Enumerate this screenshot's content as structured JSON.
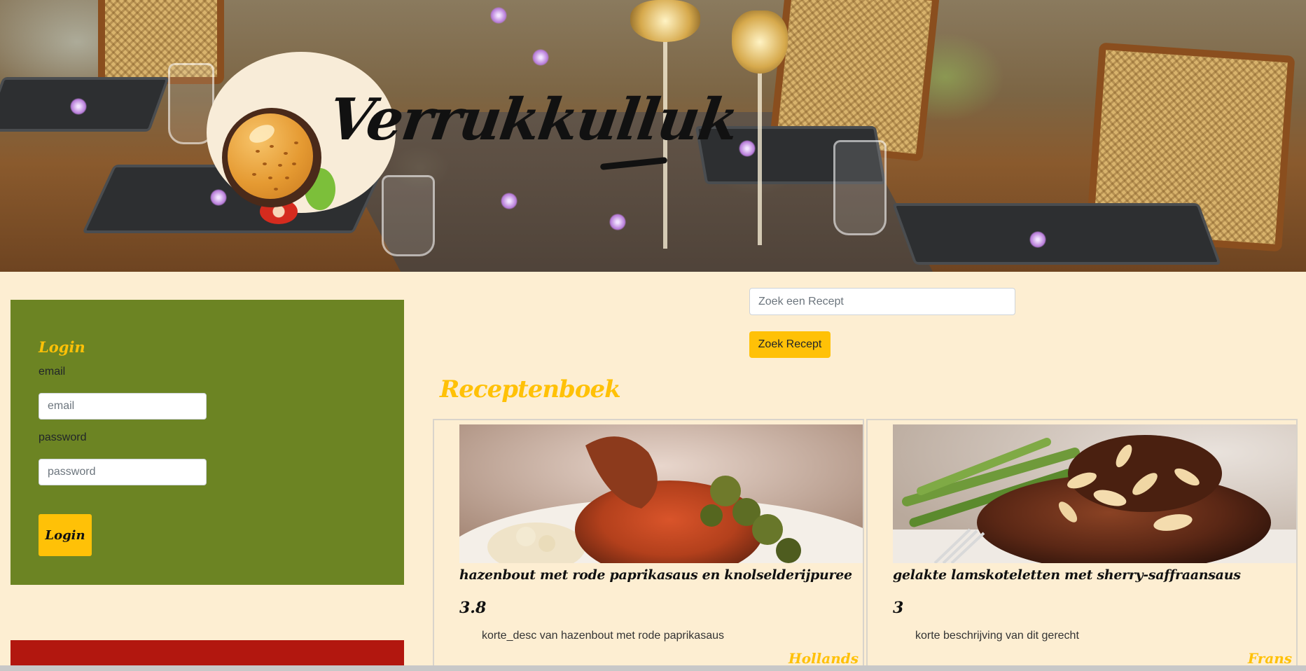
{
  "brand": {
    "name": "Verrukkulluk"
  },
  "login": {
    "title": "Login",
    "email_label": "email",
    "email_placeholder": "email",
    "password_label": "password",
    "password_placeholder": "password",
    "button_label": "Login"
  },
  "search": {
    "placeholder": "Zoek een Recept",
    "button_label": "Zoek Recept"
  },
  "recipes": {
    "heading": "Receptenboek",
    "items": [
      {
        "name": "hazenbout met rode paprikasaus en knolselderijpuree",
        "rating": "3.8",
        "description": "korte_desc van hazenbout met rode paprikasaus",
        "cuisine": "Hollands"
      },
      {
        "name": "gelakte lamskoteletten met sherry-saffraansaus",
        "rating": "3",
        "description": "korte beschrijving van dit gerecht",
        "cuisine": "Frans"
      }
    ]
  },
  "colors": {
    "background": "#fdeed2",
    "accent": "#ffc107",
    "login_panel": "#6c8423",
    "red_panel": "#b2170f"
  },
  "icons": [
    "burger-logo-icon"
  ]
}
